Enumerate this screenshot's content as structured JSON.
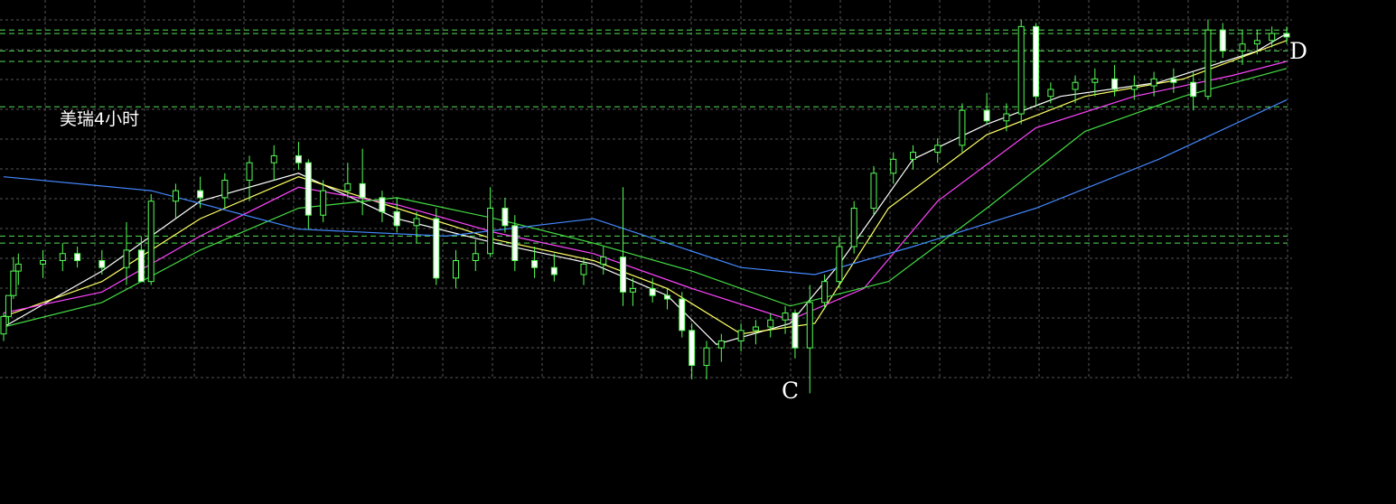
{
  "chart_data": {
    "type": "candlestick",
    "title": "美瑞4小时",
    "point_labels": [
      {
        "text": "C",
        "bar_index": 164
      },
      {
        "text": "D",
        "bar_index": 261
      }
    ],
    "horizontal_levels": [
      1.1085,
      1.1084,
      1.1079,
      1.1076,
      1.1063,
      1.1026,
      1.1024
    ],
    "ylim": [
      1.0985,
      1.1091
    ],
    "grid": true,
    "bars": 261,
    "candles": [
      [
        0,
        1.0998,
        1.1004,
        1.0996,
        1.1003
      ],
      [
        1,
        1.1003,
        1.1009,
        1.1001,
        1.1009
      ],
      [
        2,
        1.1009,
        1.102,
        1.1008,
        1.1016
      ],
      [
        3,
        1.1016,
        1.1021,
        1.1012,
        1.1018
      ],
      [
        8,
        1.1018,
        1.1022,
        1.1014,
        1.1019
      ],
      [
        12,
        1.1019,
        1.1024,
        1.1016,
        1.1021
      ],
      [
        15,
        1.1021,
        1.1023,
        1.1017,
        1.1019
      ],
      [
        20,
        1.1019,
        1.1022,
        1.1015,
        1.1017
      ],
      [
        25,
        1.1017,
        1.103,
        1.1012,
        1.1022
      ],
      [
        28,
        1.1022,
        1.1026,
        1.1017,
        1.1013
      ],
      [
        30,
        1.1013,
        1.1038,
        1.1012,
        1.1036
      ],
      [
        35,
        1.1036,
        1.1041,
        1.1031,
        1.1039
      ],
      [
        40,
        1.1039,
        1.1043,
        1.1034,
        1.1037
      ],
      [
        45,
        1.1037,
        1.1044,
        1.1034,
        1.1042
      ],
      [
        50,
        1.1042,
        1.1049,
        1.1036,
        1.1047
      ],
      [
        55,
        1.1047,
        1.1052,
        1.1042,
        1.1049
      ],
      [
        60,
        1.1049,
        1.1053,
        1.1045,
        1.1047
      ],
      [
        62,
        1.1047,
        1.1048,
        1.1028,
        1.1032
      ],
      [
        65,
        1.1032,
        1.1042,
        1.103,
        1.1039
      ],
      [
        70,
        1.1039,
        1.1047,
        1.1037,
        1.1041
      ],
      [
        73,
        1.1041,
        1.1051,
        1.1032,
        1.1037
      ],
      [
        77,
        1.1037,
        1.1039,
        1.103,
        1.1033
      ],
      [
        80,
        1.1033,
        1.1037,
        1.1027,
        1.1029
      ],
      [
        84,
        1.1029,
        1.1033,
        1.1024,
        1.1031
      ],
      [
        88,
        1.1031,
        1.1034,
        1.1012,
        1.1014
      ],
      [
        92,
        1.1014,
        1.1022,
        1.1011,
        1.1019
      ],
      [
        96,
        1.1019,
        1.1025,
        1.1016,
        1.1021
      ],
      [
        99,
        1.1021,
        1.104,
        1.102,
        1.1034
      ],
      [
        102,
        1.1034,
        1.1037,
        1.1027,
        1.1029
      ],
      [
        104,
        1.1029,
        1.1032,
        1.1016,
        1.1019
      ],
      [
        108,
        1.1019,
        1.1023,
        1.1014,
        1.1017
      ],
      [
        112,
        1.1017,
        1.1021,
        1.1013,
        1.1015
      ],
      [
        118,
        1.1015,
        1.102,
        1.1012,
        1.1018
      ],
      [
        122,
        1.1018,
        1.1023,
        1.1015,
        1.102
      ],
      [
        126,
        1.102,
        1.104,
        1.1006,
        1.101
      ],
      [
        128,
        1.101,
        1.1014,
        1.1006,
        1.1011
      ],
      [
        132,
        1.1011,
        1.1014,
        1.1007,
        1.1009
      ],
      [
        135,
        1.1009,
        1.1011,
        1.1005,
        1.1008
      ],
      [
        138,
        1.1008,
        1.101,
        1.0997,
        1.0999
      ],
      [
        140,
        1.0999,
        1.1001,
        1.0985,
        1.0989
      ],
      [
        143,
        1.0989,
        1.0996,
        1.0985,
        1.0994
      ],
      [
        146,
        1.0994,
        1.0998,
        1.099,
        1.0996
      ],
      [
        150,
        1.0996,
        1.1001,
        1.0993,
        1.0999
      ],
      [
        153,
        1.0999,
        1.1002,
        1.0995,
        1.1
      ],
      [
        156,
        1.1,
        1.1004,
        1.0997,
        1.1002
      ],
      [
        159,
        1.1002,
        1.1006,
        1.0998,
        1.1004
      ],
      [
        161,
        1.1004,
        1.1005,
        1.0991,
        1.0994
      ],
      [
        164,
        1.0994,
        1.1012,
        1.0981,
        1.1007
      ],
      [
        167,
        1.1007,
        1.1015,
        1.1005,
        1.1013
      ],
      [
        170,
        1.1013,
        1.1026,
        1.1011,
        1.1023
      ],
      [
        173,
        1.1023,
        1.1036,
        1.1021,
        1.1034
      ],
      [
        177,
        1.1034,
        1.1046,
        1.1032,
        1.1044
      ],
      [
        181,
        1.1044,
        1.105,
        1.1041,
        1.1048
      ],
      [
        185,
        1.1048,
        1.1052,
        1.1045,
        1.105
      ],
      [
        190,
        1.105,
        1.1054,
        1.1047,
        1.1052
      ],
      [
        195,
        1.1052,
        1.1064,
        1.105,
        1.1062
      ],
      [
        200,
        1.1062,
        1.1067,
        1.1058,
        1.1059
      ],
      [
        204,
        1.1059,
        1.1064,
        1.1056,
        1.1061
      ],
      [
        207,
        1.1061,
        1.1088,
        1.1058,
        1.1086
      ],
      [
        210,
        1.1086,
        1.1087,
        1.1063,
        1.1066
      ],
      [
        213,
        1.1066,
        1.107,
        1.1064,
        1.1068
      ],
      [
        218,
        1.1068,
        1.1072,
        1.1064,
        1.107
      ],
      [
        222,
        1.107,
        1.1074,
        1.1066,
        1.1071
      ],
      [
        226,
        1.1071,
        1.1075,
        1.1066,
        1.1068
      ],
      [
        230,
        1.1068,
        1.1072,
        1.1065,
        1.1069
      ],
      [
        234,
        1.1069,
        1.1073,
        1.1066,
        1.1071
      ],
      [
        238,
        1.1071,
        1.1074,
        1.1067,
        1.107
      ],
      [
        242,
        1.107,
        1.1073,
        1.1062,
        1.1066
      ],
      [
        245,
        1.1066,
        1.1088,
        1.1065,
        1.1085
      ],
      [
        248,
        1.1085,
        1.1087,
        1.1077,
        1.1079
      ],
      [
        252,
        1.1079,
        1.1085,
        1.1075,
        1.1081
      ],
      [
        255,
        1.1081,
        1.1085,
        1.1078,
        1.1082
      ],
      [
        258,
        1.1082,
        1.1086,
        1.108,
        1.1084
      ],
      [
        261,
        1.1084,
        1.1086,
        1.1081,
        1.1083
      ]
    ],
    "moving_averages": [
      {
        "color": "#ffffff",
        "values": [
          [
            0,
            1.1
          ],
          [
            20,
            1.1016
          ],
          [
            40,
            1.1036
          ],
          [
            60,
            1.1044
          ],
          [
            80,
            1.1031
          ],
          [
            100,
            1.1024
          ],
          [
            120,
            1.1018
          ],
          [
            135,
            1.1009
          ],
          [
            145,
            1.0995
          ],
          [
            160,
            1.1001
          ],
          [
            170,
            1.1018
          ],
          [
            185,
            1.1048
          ],
          [
            200,
            1.1058
          ],
          [
            215,
            1.1066
          ],
          [
            235,
            1.107
          ],
          [
            255,
            1.1079
          ],
          [
            261,
            1.1084
          ]
        ]
      },
      {
        "color": "#ffff66",
        "values": [
          [
            0,
            1.1003
          ],
          [
            20,
            1.1013
          ],
          [
            40,
            1.1031
          ],
          [
            60,
            1.1043
          ],
          [
            80,
            1.1034
          ],
          [
            100,
            1.1025
          ],
          [
            120,
            1.1019
          ],
          [
            135,
            1.1011
          ],
          [
            150,
            1.0998
          ],
          [
            165,
            1.1001
          ],
          [
            180,
            1.1034
          ],
          [
            200,
            1.1055
          ],
          [
            220,
            1.1066
          ],
          [
            240,
            1.1071
          ],
          [
            261,
            1.1082
          ]
        ]
      },
      {
        "color": "#ff44ff",
        "values": [
          [
            0,
            1.1004
          ],
          [
            20,
            1.101
          ],
          [
            40,
            1.1026
          ],
          [
            60,
            1.104
          ],
          [
            80,
            1.1035
          ],
          [
            100,
            1.1027
          ],
          [
            120,
            1.1021
          ],
          [
            140,
            1.1011
          ],
          [
            160,
            1.1002
          ],
          [
            175,
            1.1011
          ],
          [
            190,
            1.1036
          ],
          [
            210,
            1.1057
          ],
          [
            230,
            1.1066
          ],
          [
            250,
            1.1072
          ],
          [
            261,
            1.1076
          ]
        ]
      },
      {
        "color": "#44dd44",
        "values": [
          [
            0,
            1.1
          ],
          [
            20,
            1.1007
          ],
          [
            40,
            1.1022
          ],
          [
            60,
            1.1034
          ],
          [
            80,
            1.1037
          ],
          [
            100,
            1.1031
          ],
          [
            120,
            1.1024
          ],
          [
            140,
            1.1016
          ],
          [
            160,
            1.1006
          ],
          [
            180,
            1.1013
          ],
          [
            200,
            1.1034
          ],
          [
            220,
            1.1056
          ],
          [
            240,
            1.1066
          ],
          [
            261,
            1.1074
          ]
        ]
      },
      {
        "color": "#4488ff",
        "values": [
          [
            0,
            1.1043
          ],
          [
            30,
            1.1039
          ],
          [
            60,
            1.1028
          ],
          [
            90,
            1.1026
          ],
          [
            120,
            1.1031
          ],
          [
            150,
            1.1017
          ],
          [
            165,
            1.1015
          ],
          [
            185,
            1.1023
          ],
          [
            210,
            1.1034
          ],
          [
            235,
            1.1048
          ],
          [
            261,
            1.1065
          ]
        ]
      }
    ]
  }
}
